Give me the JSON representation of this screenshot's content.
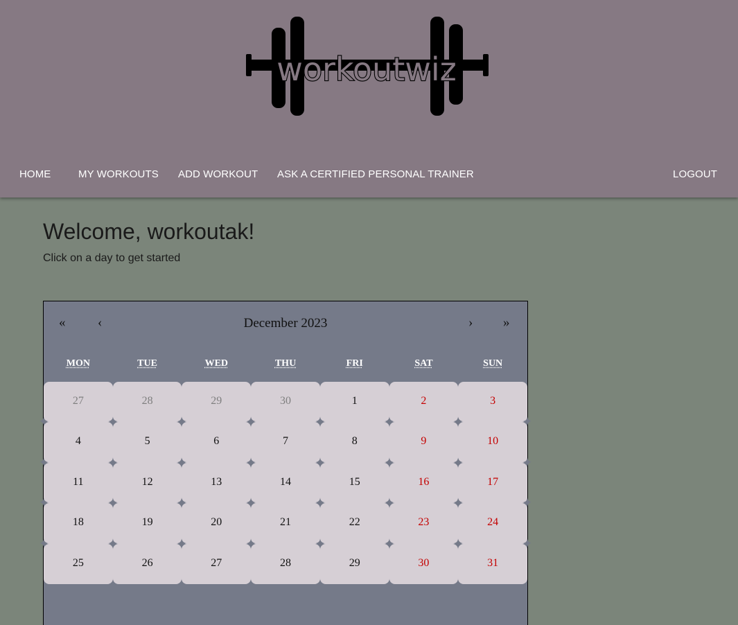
{
  "brand": {
    "logo_text": "workoutwiz"
  },
  "nav": {
    "home": "HOME",
    "my_workouts": "MY WORKOUTS",
    "add_workout": "ADD WORKOUT",
    "ask_trainer": "ASK A CERTIFIED PERSONAL TRAINER",
    "logout": "LOGOUT"
  },
  "main": {
    "welcome": "Welcome, workoutak!",
    "subtitle": "Click on a day to get started"
  },
  "calendar": {
    "prev_year": "«",
    "prev_month": "‹",
    "title": "December 2023",
    "next_month": "›",
    "next_year": "»",
    "weekdays": [
      "MON",
      "TUE",
      "WED",
      "THU",
      "FRI",
      "SAT",
      "SUN"
    ],
    "days": [
      {
        "label": "27",
        "other": true
      },
      {
        "label": "28",
        "other": true
      },
      {
        "label": "29",
        "other": true
      },
      {
        "label": "30",
        "other": true
      },
      {
        "label": "1"
      },
      {
        "label": "2",
        "weekend": true
      },
      {
        "label": "3",
        "weekend": true
      },
      {
        "label": "4"
      },
      {
        "label": "5"
      },
      {
        "label": "6"
      },
      {
        "label": "7"
      },
      {
        "label": "8"
      },
      {
        "label": "9",
        "weekend": true
      },
      {
        "label": "10",
        "weekend": true
      },
      {
        "label": "11"
      },
      {
        "label": "12"
      },
      {
        "label": "13"
      },
      {
        "label": "14"
      },
      {
        "label": "15"
      },
      {
        "label": "16",
        "weekend": true
      },
      {
        "label": "17",
        "weekend": true
      },
      {
        "label": "18"
      },
      {
        "label": "19"
      },
      {
        "label": "20"
      },
      {
        "label": "21"
      },
      {
        "label": "22"
      },
      {
        "label": "23",
        "weekend": true
      },
      {
        "label": "24",
        "weekend": true
      },
      {
        "label": "25"
      },
      {
        "label": "26"
      },
      {
        "label": "27"
      },
      {
        "label": "28"
      },
      {
        "label": "29"
      },
      {
        "label": "30",
        "weekend": true
      },
      {
        "label": "31",
        "weekend": true
      }
    ]
  },
  "colors": {
    "header_bg": "#867983",
    "page_bg": "#7b857a",
    "calendar_bg": "#757a89",
    "day_tile": "#d6cfd5",
    "weekend_text": "#c40000"
  }
}
